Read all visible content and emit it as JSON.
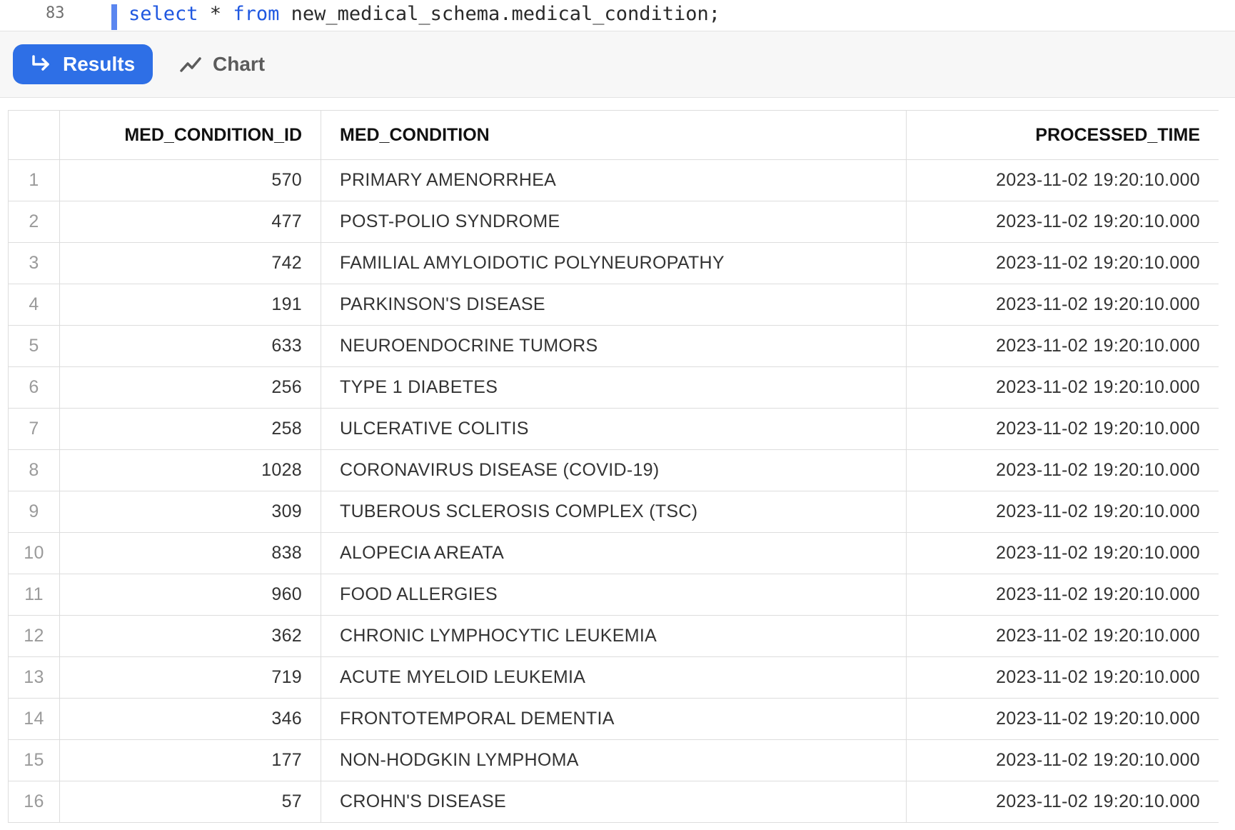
{
  "editor": {
    "line_number": "83",
    "code": {
      "kw_select": "select",
      "star": " * ",
      "kw_from": "from",
      "rest": " new_medical_schema.medical_condition;"
    }
  },
  "toolbar": {
    "results_label": "Results",
    "chart_label": "Chart",
    "accent_color": "#2e6fe6"
  },
  "table": {
    "columns": [
      "MED_CONDITION_ID",
      "MED_CONDITION",
      "PROCESSED_TIME"
    ],
    "rows": [
      {
        "index": "1",
        "id": "570",
        "condition": "PRIMARY AMENORRHEA",
        "time": "2023-11-02 19:20:10.000"
      },
      {
        "index": "2",
        "id": "477",
        "condition": "POST-POLIO SYNDROME",
        "time": "2023-11-02 19:20:10.000"
      },
      {
        "index": "3",
        "id": "742",
        "condition": "FAMILIAL AMYLOIDOTIC POLYNEUROPATHY",
        "time": "2023-11-02 19:20:10.000"
      },
      {
        "index": "4",
        "id": "191",
        "condition": "PARKINSON'S DISEASE",
        "time": "2023-11-02 19:20:10.000"
      },
      {
        "index": "5",
        "id": "633",
        "condition": "NEUROENDOCRINE TUMORS",
        "time": "2023-11-02 19:20:10.000"
      },
      {
        "index": "6",
        "id": "256",
        "condition": "TYPE 1 DIABETES",
        "time": "2023-11-02 19:20:10.000"
      },
      {
        "index": "7",
        "id": "258",
        "condition": "ULCERATIVE COLITIS",
        "time": "2023-11-02 19:20:10.000"
      },
      {
        "index": "8",
        "id": "1028",
        "condition": "CORONAVIRUS DISEASE (COVID-19)",
        "time": "2023-11-02 19:20:10.000"
      },
      {
        "index": "9",
        "id": "309",
        "condition": "TUBEROUS SCLEROSIS COMPLEX (TSC)",
        "time": "2023-11-02 19:20:10.000"
      },
      {
        "index": "10",
        "id": "838",
        "condition": "ALOPECIA AREATA",
        "time": "2023-11-02 19:20:10.000"
      },
      {
        "index": "11",
        "id": "960",
        "condition": "FOOD ALLERGIES",
        "time": "2023-11-02 19:20:10.000"
      },
      {
        "index": "12",
        "id": "362",
        "condition": "CHRONIC LYMPHOCYTIC LEUKEMIA",
        "time": "2023-11-02 19:20:10.000"
      },
      {
        "index": "13",
        "id": "719",
        "condition": "ACUTE MYELOID LEUKEMIA",
        "time": "2023-11-02 19:20:10.000"
      },
      {
        "index": "14",
        "id": "346",
        "condition": "FRONTOTEMPORAL DEMENTIA",
        "time": "2023-11-02 19:20:10.000"
      },
      {
        "index": "15",
        "id": "177",
        "condition": "NON-HODGKIN LYMPHOMA",
        "time": "2023-11-02 19:20:10.000"
      },
      {
        "index": "16",
        "id": "57",
        "condition": "CROHN'S DISEASE",
        "time": "2023-11-02 19:20:10.000"
      }
    ]
  }
}
